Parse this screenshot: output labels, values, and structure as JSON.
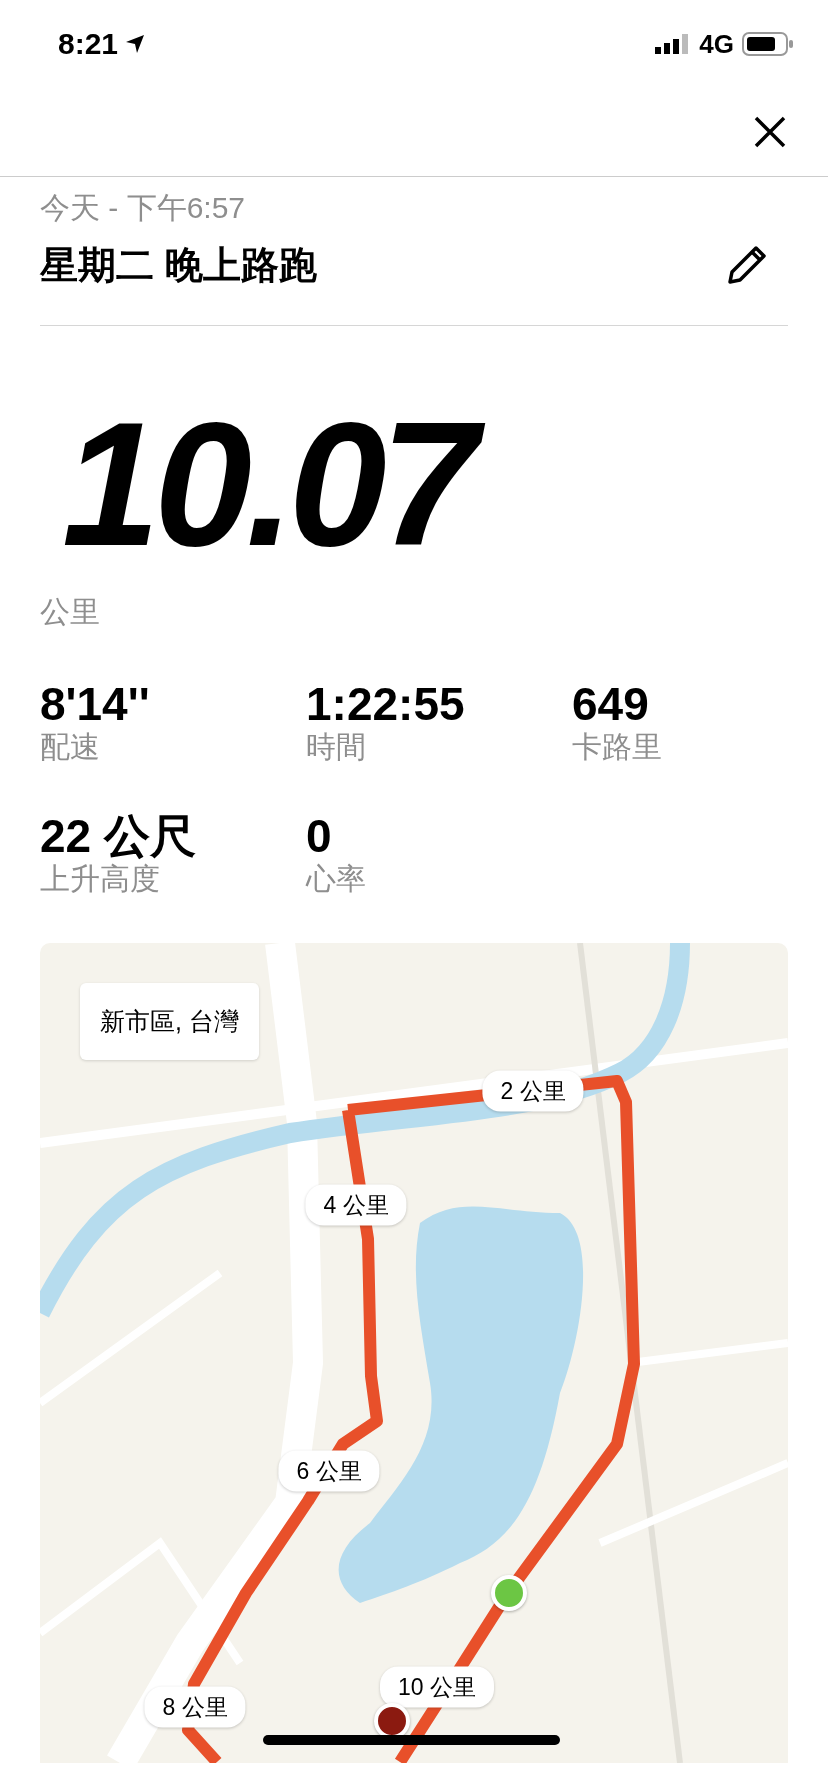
{
  "status_bar": {
    "time": "8:21",
    "network": "4G"
  },
  "activity": {
    "date": "今天 - 下午6:57",
    "title": "星期二 晚上路跑"
  },
  "distance": {
    "value": "10.07",
    "unit": "公里"
  },
  "stats": [
    {
      "value": "8'14''",
      "label": "配速"
    },
    {
      "value": "1:22:55",
      "label": "時間"
    },
    {
      "value": "649",
      "label": "卡路里"
    },
    {
      "value": "22 公尺",
      "label": "上升高度"
    },
    {
      "value": "0",
      "label": "心率"
    }
  ],
  "map": {
    "kind": "picture",
    "location": "新市區, 台灣",
    "markers": [
      {
        "label": "2 公里"
      },
      {
        "label": "4 公里"
      },
      {
        "label": "6 公里"
      },
      {
        "label": "10 公里"
      },
      {
        "label": "8 公里"
      }
    ],
    "points": [
      {
        "kind": "start",
        "color": "#6cc644"
      },
      {
        "kind": "end",
        "color": "#8b1a10"
      }
    ]
  }
}
